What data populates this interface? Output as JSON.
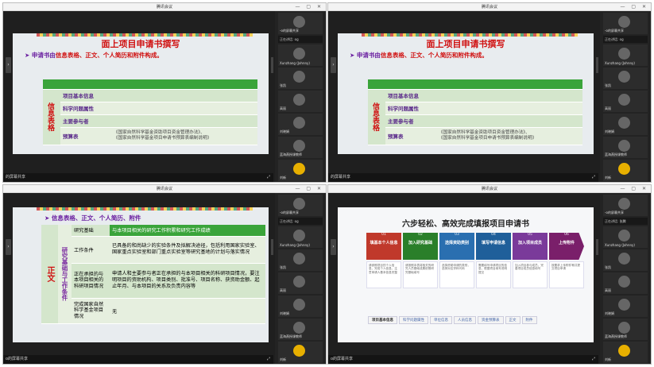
{
  "app_title": "腾讯会议",
  "share_label": "的屏幕共享",
  "windows": [
    {
      "title": "腾讯会议",
      "bottom": "的屏幕共享",
      "participants": [
        {
          "name": "-o的屏幕共享"
        },
        {
          "name": "Xunzhang (Johnny)"
        },
        {
          "name": "张凯"
        },
        {
          "name": "高丽"
        },
        {
          "name": "刘晓娟"
        },
        {
          "name": "蓝海燕授课教师"
        },
        {
          "name": "刘新"
        }
      ],
      "selector": "正在讲话: og"
    },
    {
      "title": "腾讯会议",
      "bottom": "的屏幕共享",
      "participants": [
        {
          "name": "-o的屏幕共享"
        },
        {
          "name": "Xunzhang (Johnny)"
        },
        {
          "name": "张凯"
        },
        {
          "name": "高丽"
        },
        {
          "name": "刘晓娟"
        },
        {
          "name": "蓝海燕授课教师"
        },
        {
          "name": "刘新"
        }
      ],
      "selector": "正在讲话: og"
    },
    {
      "title": "腾讯会议",
      "bottom": "o的屏幕共享",
      "participants": [
        {
          "name": "-o的屏幕共享"
        },
        {
          "name": "Xunzhang (Johnny)"
        },
        {
          "name": "张凯"
        },
        {
          "name": "高丽"
        },
        {
          "name": "刘晓娟"
        },
        {
          "name": "蓝海燕授课教师"
        },
        {
          "name": "刘新"
        }
      ],
      "selector": "正在讲话: og"
    },
    {
      "title": "腾讯会议",
      "bottom": "o的屏幕共享",
      "participants": [
        {
          "name": "-o的屏幕共享"
        },
        {
          "name": "Xunzhang (Johnny)"
        },
        {
          "name": "张凯"
        },
        {
          "name": "高丽"
        },
        {
          "name": "刘晓娟"
        },
        {
          "name": "蓝海燕授课教师"
        },
        {
          "name": "刘新"
        }
      ],
      "selector": "正在讲话: 张腾"
    }
  ],
  "slide1": {
    "title": "面上项目申请书撰写",
    "subtitle_pre": "申请书由",
    "subtitle_hl": "信息表格、正文、个人简历和附件构成。",
    "side": "信息表格",
    "rows": [
      "项目基本信息",
      "科学问题属性",
      "主要参与者",
      "预算表"
    ],
    "budget_note_1": "《国家自然科学基金资助项目资金管理办法》、",
    "budget_note_2": "《国家自然科学基金项目申请书预算表编制说明》"
  },
  "slide2": {
    "subtitle": "信息表格、正文、个人简历、附件",
    "side_left": "正文",
    "side_mid": "研究基础与工作条件",
    "rows": [
      {
        "k": "研究基础",
        "v": "与本项目相关的研究工作积累和研究工作成绩"
      },
      {
        "k": "工作条件",
        "v": "已具备的和尚缺少的实验条件及拟解决途径，包括利用国家实验室、国家重点实验室和部门重点实验室等研究基地的计划与落实情况"
      },
      {
        "k": "正在承担的与本项目相关的科研项目情况",
        "v": "申请人和主要参与者正在承担的与本项目相关的科研项目情况，要注明项目的资助机构、项目类别、批准号、项目名称、获资助金额、起止年月、与本项目的关系及负责内容等"
      },
      {
        "k": "完成国家自然科学基金项目情况",
        "v": "无"
      }
    ]
  },
  "slide3": {
    "title": "六步轻松、高效完成填报项目申请书",
    "steps": [
      {
        "n": "01",
        "label": "填基本个人信息",
        "desc": "请参照项目的个人信息，完成个人信息，注意申请人基本信息完整",
        "color": "#c0392b"
      },
      {
        "n": "02",
        "label": "加入研究基础",
        "desc": "请按照本表将相关的研究人员基础成果依照研究基础填写",
        "color": "#2a7f2a"
      },
      {
        "n": "03",
        "label": "选择资助类别",
        "desc": "选择资助申请的类别，选择对应学科代码",
        "color": "#2a6fb0"
      },
      {
        "n": "04",
        "label": "填写申请信息",
        "desc": "需要填写申请项目的信息，根据项目填写说明提交",
        "color": "#1f5f9a"
      },
      {
        "n": "05",
        "label": "加入项目成员",
        "desc": "加入项目参与成员，完善项目成员信息填写",
        "color": "#7a3a9a"
      },
      {
        "n": "06",
        "label": "上传附件",
        "desc": "按要求上传附件等并提交项目申请",
        "color": "#7a1f6a"
      }
    ],
    "tabs": [
      "项目基本信息",
      "科学问题属性",
      "单位信息",
      "人员信息",
      "资金预算表",
      "正文",
      "附件"
    ]
  }
}
